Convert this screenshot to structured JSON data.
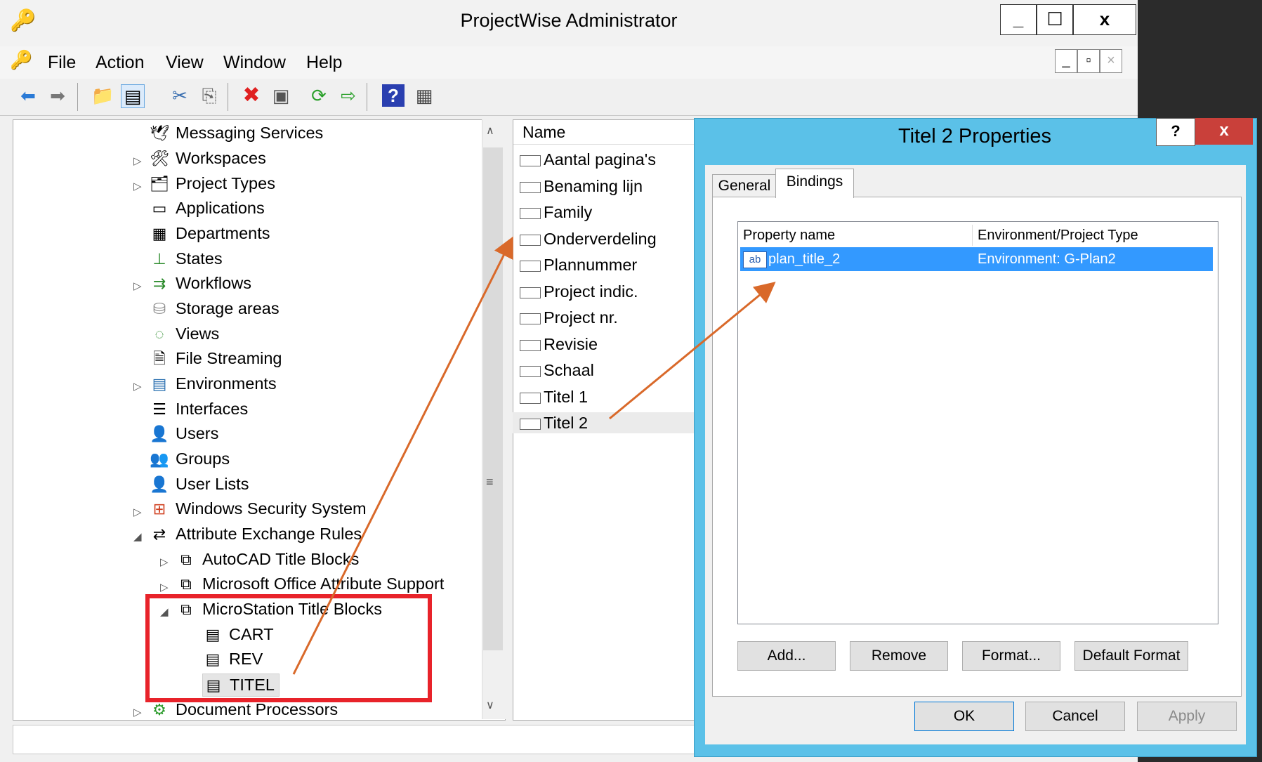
{
  "window": {
    "title": "ProjectWise Administrator",
    "controls": [
      "_",
      "☐",
      "x"
    ]
  },
  "menubar": {
    "items": [
      "File",
      "Action",
      "View",
      "Window",
      "Help"
    ]
  },
  "toolbar": {
    "icons": [
      "back-arrow-icon",
      "forward-arrow-icon",
      "up-folder-icon",
      "show-hide-tree-icon",
      "cut-icon",
      "copy-icon",
      "delete-icon",
      "properties-icon",
      "refresh-icon",
      "export-icon",
      "help-icon",
      "view-icon"
    ]
  },
  "tree": {
    "items": [
      {
        "label": "Messaging Services",
        "icon": "🕊"
      },
      {
        "label": "Workspaces",
        "icon": "🛠"
      },
      {
        "label": "Project Types",
        "icon": "🗂"
      },
      {
        "label": "Applications",
        "icon": "▭"
      },
      {
        "label": "Departments",
        "icon": "▦"
      },
      {
        "label": "States",
        "icon": "⊥"
      },
      {
        "label": "Workflows",
        "icon": "⇉"
      },
      {
        "label": "Storage areas",
        "icon": "⛁"
      },
      {
        "label": "Views",
        "icon": "◌"
      },
      {
        "label": "File Streaming",
        "icon": "🗎"
      },
      {
        "label": "Environments",
        "icon": "▤"
      },
      {
        "label": "Interfaces",
        "icon": "☰"
      },
      {
        "label": "Users",
        "icon": "👤"
      },
      {
        "label": "Groups",
        "icon": "👥"
      },
      {
        "label": "User Lists",
        "icon": "👤"
      },
      {
        "label": "Windows Security System",
        "icon": "⊞"
      },
      {
        "label": "Attribute Exchange Rules",
        "icon": "⇄"
      },
      {
        "label": "AutoCAD Title Blocks",
        "icon": "⧉"
      },
      {
        "label": "Microsoft Office Attribute Support",
        "icon": "⧉"
      },
      {
        "label": "MicroStation Title Blocks",
        "icon": "⧉"
      },
      {
        "label": "CART",
        "icon": "▤"
      },
      {
        "label": "REV",
        "icon": "▤"
      },
      {
        "label": "TITEL",
        "icon": "▤"
      },
      {
        "label": "Document Processors",
        "icon": "⚙"
      }
    ]
  },
  "list": {
    "header": "Name",
    "items": [
      "Aantal pagina's",
      "Benaming lijn",
      "Family",
      "Onderverdeling",
      "Plannummer",
      "Project indic.",
      "Project nr.",
      "Revisie",
      "Schaal",
      "Titel 1",
      "Titel 2"
    ]
  },
  "dialog": {
    "title": "Titel 2 Properties",
    "help": "?",
    "close": "x",
    "tabs": [
      "General",
      "Bindings"
    ],
    "grid": {
      "headers": [
        "Property name",
        "Environment/Project Type"
      ],
      "rows": [
        {
          "icon": "ab",
          "name": "plan_title_2",
          "env": "Environment: G-Plan2"
        }
      ]
    },
    "buttons": {
      "add": "Add...",
      "remove": "Remove",
      "format": "Format...",
      "default_format": "Default Format",
      "ok": "OK",
      "cancel": "Cancel",
      "apply": "Apply"
    }
  },
  "colors": {
    "highlight": "#3399ff",
    "dialog_frame": "#5bc1e8",
    "annotation_arrow": "#d9692a",
    "annotation_box": "#e8232a"
  }
}
